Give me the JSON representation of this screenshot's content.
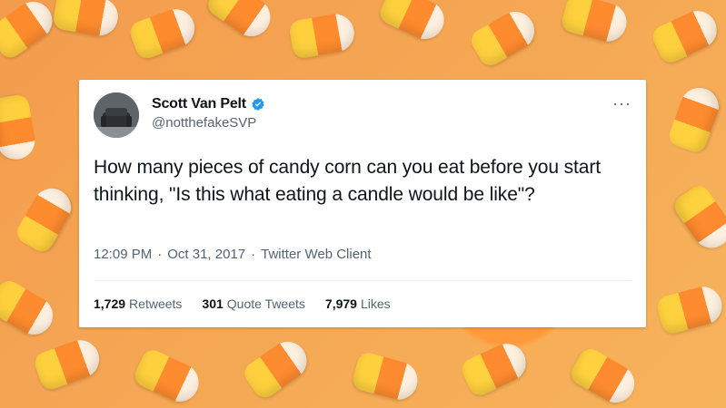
{
  "background": {
    "theme": "candy-corn",
    "colors": [
      "#ffd33d",
      "#ff8a2d",
      "#fff4e6"
    ]
  },
  "tweet": {
    "display_name": "Scott Van Pelt",
    "handle": "@notthefakeSVP",
    "verified_icon": "verified-badge-icon",
    "more_icon": "more-options-icon",
    "text": "How many pieces of candy corn can you eat before you start thinking, \"Is this what eating a candle would be like\"?",
    "time": "12:09 PM",
    "date": "Oct 31, 2017",
    "client": "Twitter Web Client",
    "stats": {
      "retweets_count": "1,729",
      "retweets_label": "Retweets",
      "quotes_count": "301",
      "quotes_label": "Quote Tweets",
      "likes_count": "7,979",
      "likes_label": "Likes"
    },
    "accent": "#1d9bf0",
    "text_color": "#0f1419",
    "muted_color": "#536471"
  }
}
